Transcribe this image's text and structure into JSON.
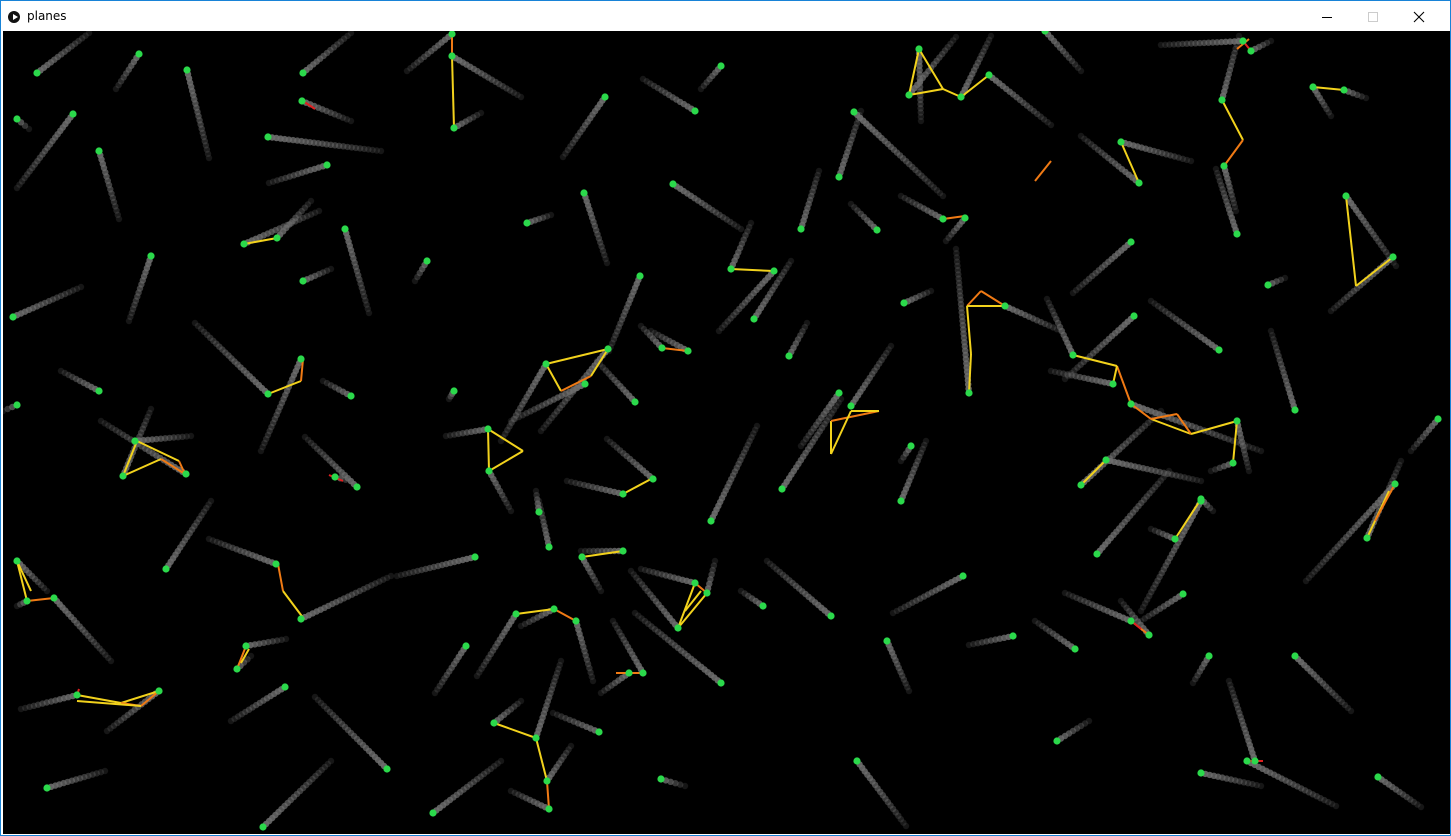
{
  "window": {
    "title": "planes"
  },
  "colors": {
    "trail": "#6e6e6e",
    "plane": "#2bd94b",
    "link_near": "#f2d21c",
    "link_close": "#f07a14",
    "link_collision": "#e02020",
    "canvas_bg": "#000000"
  },
  "icons": {
    "app": "play-circle-icon",
    "minimize": "minimize-icon",
    "maximize": "maximize-icon",
    "close": "close-icon"
  }
}
